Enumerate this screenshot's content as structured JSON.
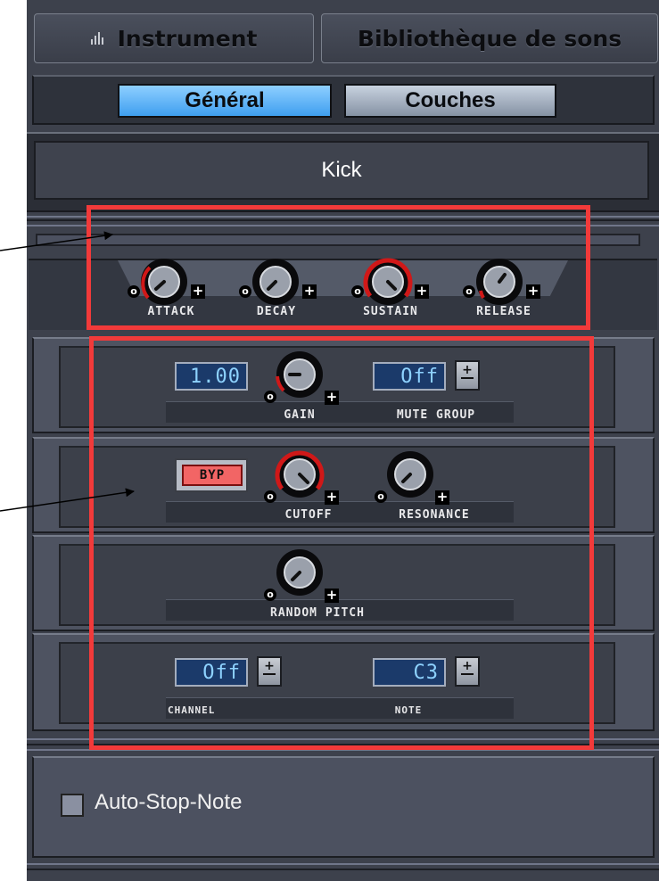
{
  "header": {
    "tabs": [
      {
        "label": "Instrument",
        "icon": "bars-icon"
      },
      {
        "label": "Bibliothèque de sons"
      }
    ]
  },
  "subtabs": [
    {
      "label": "Général",
      "active": true
    },
    {
      "label": "Couches",
      "active": false
    }
  ],
  "instrument_name": "Kick",
  "adsr": {
    "knobs": [
      {
        "label": "ATTACK",
        "min": "o",
        "max": "+"
      },
      {
        "label": "DECAY",
        "min": "o",
        "max": "+"
      },
      {
        "label": "SUSTAIN",
        "min": "o",
        "max": "+"
      },
      {
        "label": "RELEASE",
        "min": "o",
        "max": "+"
      }
    ]
  },
  "rows": {
    "gain": {
      "value": "1.00",
      "knob_label": "GAIN",
      "min": "o",
      "max": "+"
    },
    "mute_group": {
      "value": "Off",
      "label": "MUTE GROUP"
    },
    "filter": {
      "bypass_label": "BYP",
      "cutoff_label": "CUTOFF",
      "resonance_label": "RESONANCE",
      "min": "o",
      "max": "+"
    },
    "random_pitch": {
      "label": "RANDOM PITCH",
      "min": "o",
      "max": "+"
    },
    "midi": {
      "channel_value": "Off",
      "channel_label": "CHANNEL",
      "note_value": "C3",
      "note_label": "NOTE"
    }
  },
  "stepper": {
    "plus": "+"
  },
  "auto_stop_note": {
    "label": "Auto-Stop-Note",
    "checked": false
  },
  "colors": {
    "panel_bg": "#3d414c",
    "active_tab": "#5eb4ff",
    "lcd_bg": "#1b3a6a",
    "lcd_text": "#8ed2ff",
    "knob_ring_red": "#d01818",
    "highlight_red": "#f23a3a"
  }
}
